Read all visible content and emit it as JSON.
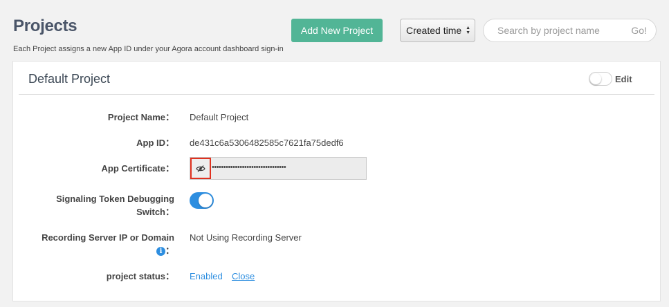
{
  "header": {
    "title": "Projects",
    "subtitle": "Each Project assigns a new App ID under your Agora account dashboard sign-in",
    "add_button_label": "Add New Project",
    "sort_value": "Created time",
    "search_placeholder": "Search by project name",
    "search_go_label": "Go!"
  },
  "project": {
    "title": "Default Project",
    "edit_label": "Edit",
    "edit_toggle_on": false,
    "fields": {
      "name_label": "Project Name：",
      "name_value": "Default Project",
      "app_id_label": "App ID：",
      "app_id_value": "de431c6a5306482585c7621fa75dedf6",
      "cert_label": "App Certificate：",
      "cert_masked": "••••••••••••••••••••••••••••••••",
      "signaling_label_line1": "Signaling Token Debugging",
      "signaling_label_line2": "Switch：",
      "signaling_on": true,
      "recording_label_line1": "Recording Server IP or Domain",
      "recording_colon": "：",
      "recording_value": "Not Using Recording Server",
      "status_label": "project status：",
      "status_value": "Enabled",
      "status_action": "Close"
    }
  },
  "colors": {
    "accent_green": "#52b596",
    "accent_blue": "#2d8ee0",
    "highlight_red": "#e0311f"
  },
  "icons": {
    "select_arrows": "select-arrows-icon",
    "eye_toggle": "eye-slash-icon",
    "info": "info-icon"
  }
}
